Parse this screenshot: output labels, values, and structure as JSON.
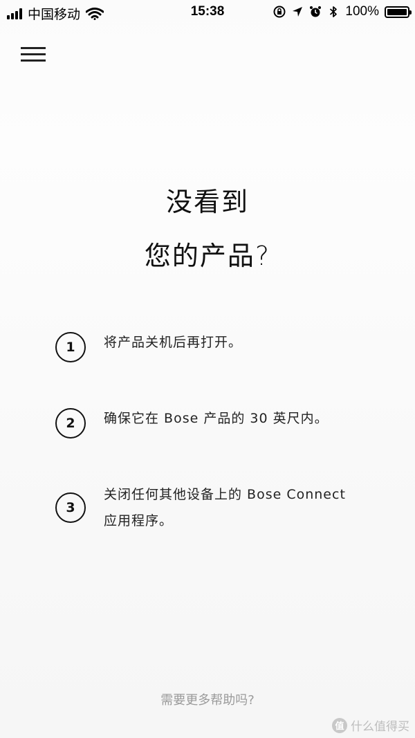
{
  "status_bar": {
    "carrier": "中国移动",
    "time": "15:38",
    "battery": "100%",
    "icons": [
      "signal-icon",
      "wifi-icon",
      "rotation-lock-icon",
      "location-icon",
      "alarm-icon",
      "bluetooth-icon",
      "battery-icon"
    ]
  },
  "header": {
    "menu_icon": "hamburger-menu-icon"
  },
  "main": {
    "heading_line1": "没看到",
    "heading_line2": "您的产品?",
    "steps": [
      {
        "number": "1",
        "text": "将产品关机后再打开。"
      },
      {
        "number": "2",
        "text": "确保它在 Bose 产品的 30 英尺内。"
      },
      {
        "number": "3",
        "text_line1": "关闭任何其他设备上的 Bose Connect",
        "text_line2": "应用程序。"
      }
    ]
  },
  "footer": {
    "help_link": "需要更多帮助吗?"
  },
  "watermark": {
    "logo": "值",
    "text": "什么值得买"
  }
}
